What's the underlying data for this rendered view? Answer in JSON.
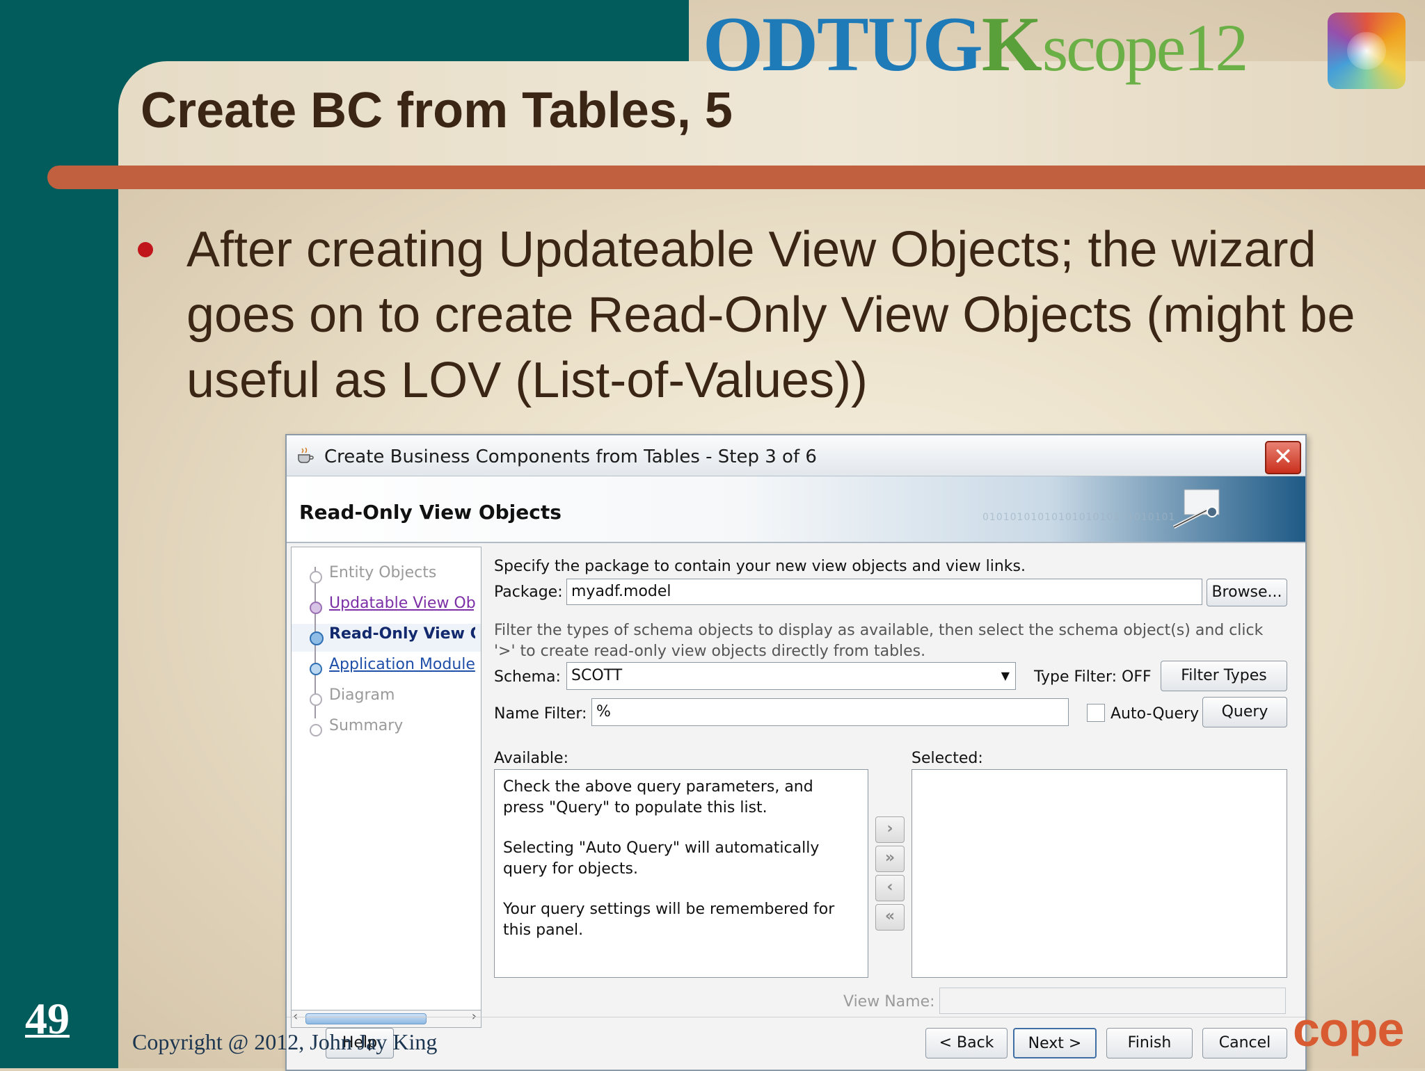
{
  "slide": {
    "title": "Create BC from Tables, 5",
    "bullet": "After creating Updateable View Objects; the wizard goes on to create Read-Only View Objects (might be useful as LOV (List-of-Values))",
    "number": "49",
    "copyright": "Copyright @ 2012, John Jay King",
    "footer_logo": "cope",
    "logo_odtug": "ODTUG",
    "logo_k": "K",
    "logo_scope": "scope12",
    "colors": {
      "teal": "#035c5c",
      "orange_bar": "#c0603e",
      "bullet": "#c0151b",
      "title_text": "#3b2616"
    }
  },
  "dialog": {
    "window_title": "Create Business Components from Tables - Step 3 of 6",
    "page_title": "Read-Only View Objects",
    "header_bits": "0101010101010101010101010101",
    "nav_items": [
      {
        "label": "Entity Objects",
        "state": "done"
      },
      {
        "label": "Updatable View Objects",
        "state": "visited"
      },
      {
        "label": "Read-Only View Objects",
        "state": "current"
      },
      {
        "label": "Application Module",
        "state": "link"
      },
      {
        "label": "Diagram",
        "state": "disabled"
      },
      {
        "label": "Summary",
        "state": "disabled"
      }
    ],
    "package_instructions": "Specify the package to contain your new view objects and view links.",
    "package_label": "Package:",
    "package_value": "myadf.model",
    "browse_label": "Browse...",
    "filter_instructions": "Filter the types of schema objects to display as available, then select the schema object(s) and click '>' to create read-only view objects directly from tables.",
    "schema_label": "Schema:",
    "schema_value": "SCOTT",
    "type_filter_label": "Type Filter: OFF",
    "filter_types_label": "Filter Types",
    "name_filter_label": "Name Filter:",
    "name_filter_value": "%",
    "auto_query_label": "Auto-Query",
    "auto_query_checked": false,
    "query_label": "Query",
    "available_label": "Available:",
    "selected_label": "Selected:",
    "available_hint_1": "Check the above query parameters, and press \"Query\" to populate this list.",
    "available_hint_2": "Selecting \"Auto Query\" will automatically query for objects.",
    "available_hint_3": "Your query settings will be remembered for this panel.",
    "view_name_label": "View Name:",
    "view_name_value": "",
    "help_label": "Help",
    "back_label": "< Back",
    "next_label": "Next >",
    "finish_label": "Finish",
    "cancel_label": "Cancel"
  }
}
